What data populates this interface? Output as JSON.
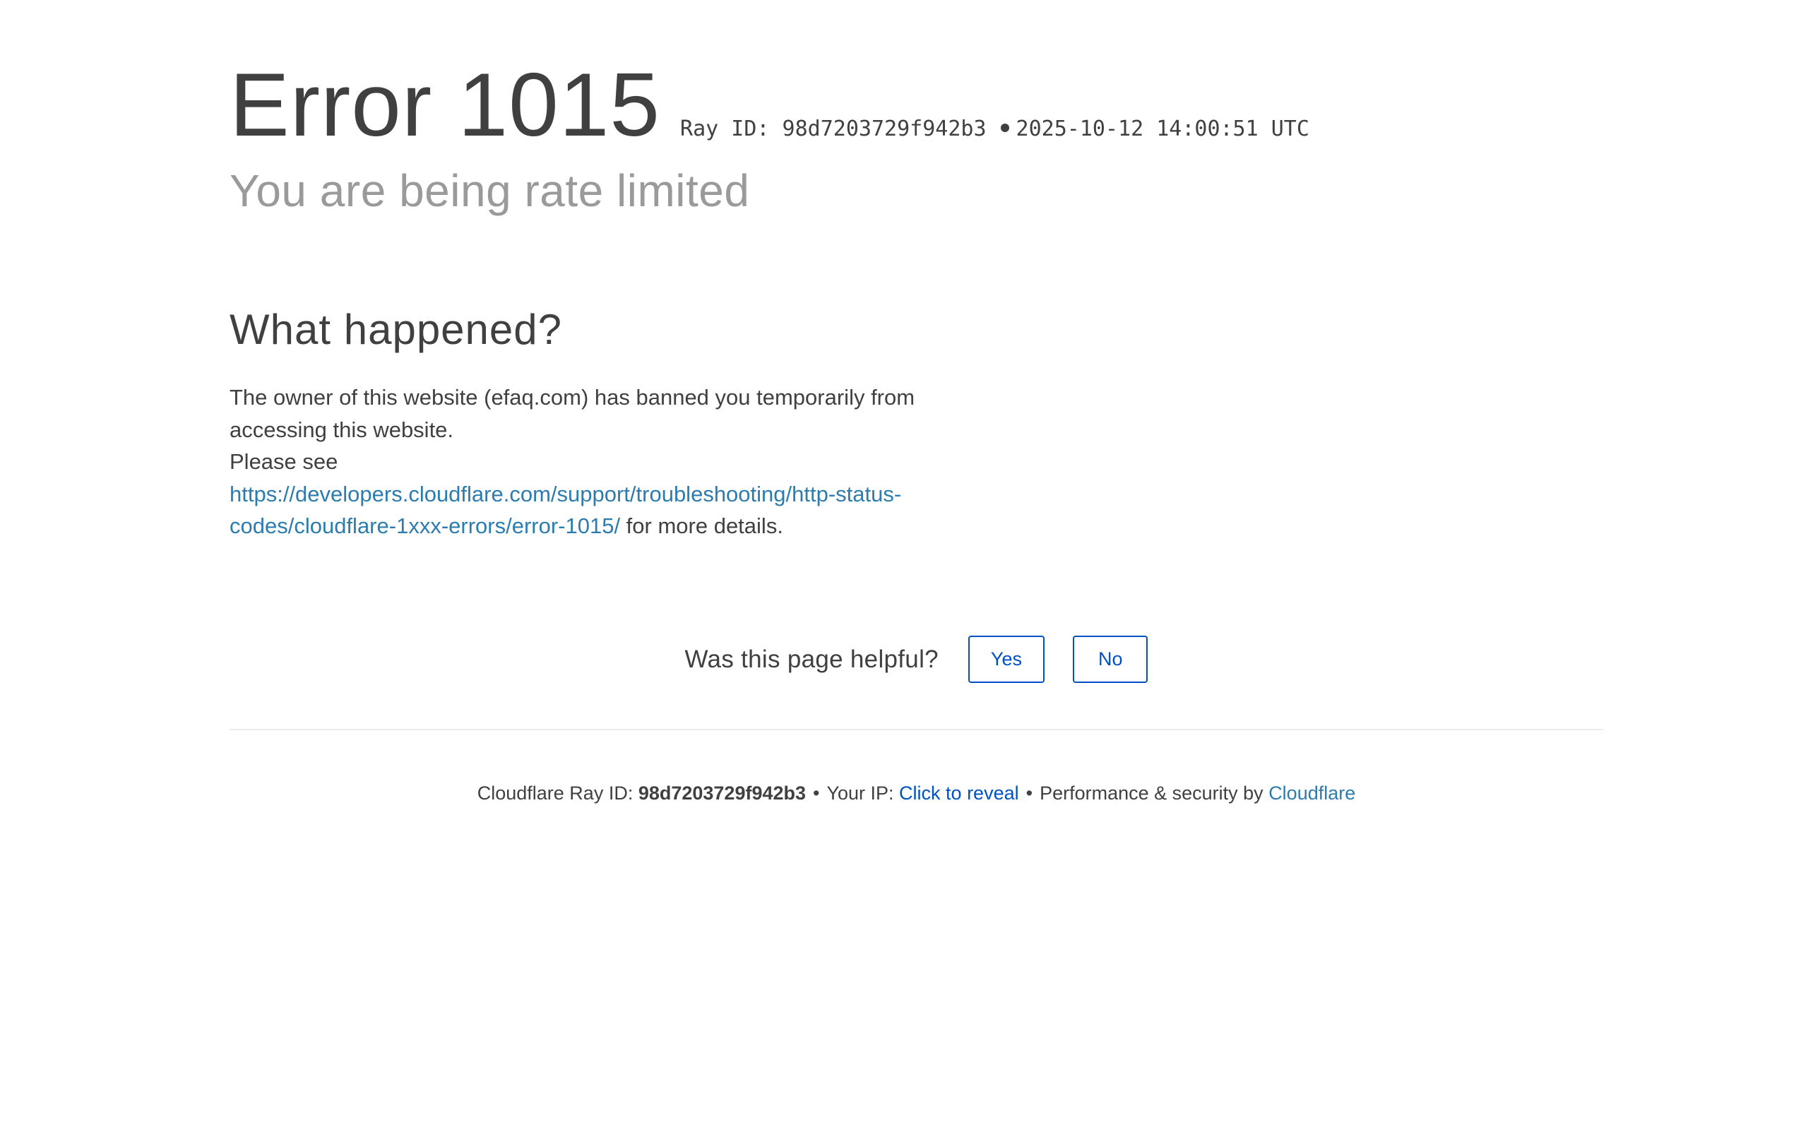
{
  "header": {
    "error_title": "Error 1015",
    "ray_label": "Ray ID: 98d7203729f942b3",
    "timestamp": "2025-10-12 14:00:51 UTC",
    "subtitle": "You are being rate limited"
  },
  "main": {
    "section_title": "What happened?",
    "paragraph_1": "The owner of this website (efaq.com) has banned you temporarily from accessing this website.",
    "please_see": "Please see",
    "details_link": "https://developers.cloudflare.com/support/troubleshooting/http-status-codes/cloudflare-1xxx-errors/error-1015/",
    "details_suffix": " for more details."
  },
  "feedback": {
    "question": "Was this page helpful?",
    "yes_label": "Yes",
    "no_label": "No"
  },
  "footer": {
    "ray_prefix": "Cloudflare Ray ID: ",
    "ray_id": "98d7203729f942b3",
    "separator": "•",
    "ip_prefix": "Your IP: ",
    "ip_reveal": "Click to reveal",
    "perf_text": "Performance & security by ",
    "cloudflare_link": "Cloudflare"
  },
  "colors": {
    "text": "#404040",
    "subtitle": "#9a9a9a",
    "link": "#2c7cb0",
    "button": "#0051c3"
  }
}
